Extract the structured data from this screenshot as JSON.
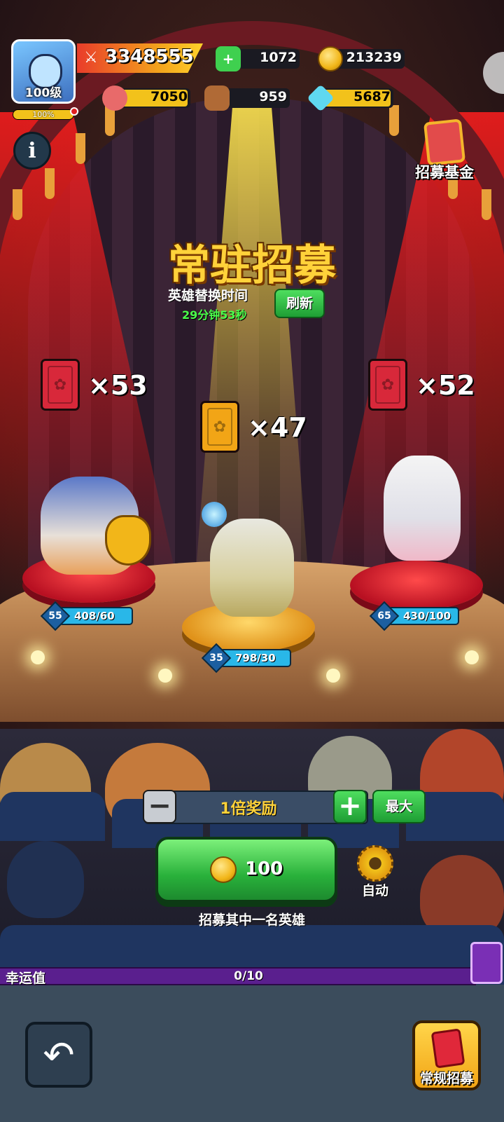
{
  "player": {
    "level_label": "100级",
    "xp_percent_label": "100%",
    "xp_fraction": 1.0
  },
  "resources": {
    "power": "3348555",
    "gems": "1072",
    "gold": "213239",
    "meat": "7050",
    "wood": "959",
    "crystal": "5687"
  },
  "buttons": {
    "info": "i",
    "fund": "招募基金",
    "refresh": "刷新",
    "minus": "−",
    "plus": "+",
    "max": "最大",
    "auto": "自动",
    "regular_recruit": "常规招募",
    "back": "↶"
  },
  "recruit": {
    "title": "常驻招募",
    "swap_label": "英雄替换时间",
    "swap_timer": "29分钟53秒",
    "multiplier": "1倍奖励",
    "cost": "100",
    "hint": "招募其中一名英雄"
  },
  "heroes": [
    {
      "card_count": "×53",
      "level": "55",
      "fragments": "408/60",
      "card_color": "red"
    },
    {
      "card_count": "×47",
      "level": "35",
      "fragments": "798/30",
      "card_color": "gold"
    },
    {
      "card_count": "×52",
      "level": "65",
      "fragments": "430/100",
      "card_color": "red"
    }
  ],
  "luck": {
    "label": "幸运值",
    "value": "0/10",
    "fraction": 0
  },
  "colors": {
    "accent_green": "#29b13b",
    "accent_gold": "#ffd23a",
    "pedestal_red": "#d8283a",
    "pedestal_gold": "#f2a516",
    "luck_purple": "#5a1f8e"
  }
}
